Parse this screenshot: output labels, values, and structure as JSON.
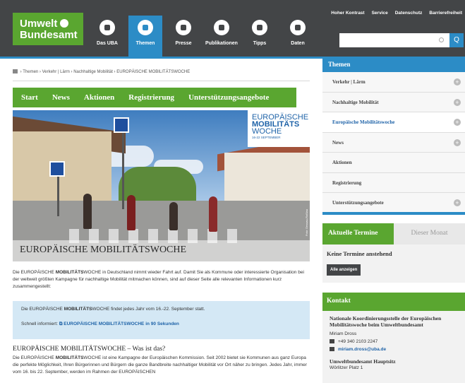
{
  "header": {
    "logo_line1": "Umwelt",
    "logo_line2": "Bundesamt",
    "nav": [
      {
        "label": "Das UBA",
        "icon": "speech-bubble-icon"
      },
      {
        "label": "Themen",
        "icon": "grid-icon",
        "active": true
      },
      {
        "label": "Presse",
        "icon": "megaphone-icon"
      },
      {
        "label": "Publikationen",
        "icon": "document-icon"
      },
      {
        "label": "Tipps",
        "icon": "lightbulb-icon"
      },
      {
        "label": "Daten",
        "icon": "bar-chart-icon"
      }
    ],
    "toplinks": [
      "Hoher Kontrast",
      "Service",
      "Datenschutz",
      "Barrierefreiheit"
    ],
    "search_placeholder": "",
    "search_button": "Q"
  },
  "breadcrumb": [
    "Themen",
    "Verkehr | Lärm",
    "Nachhaltige Mobilität",
    "EUROPÄISCHE MOBILITÄTSWOCHE"
  ],
  "subnav": [
    "Start",
    "News",
    "Aktionen",
    "Registrierung",
    "Unterstützungsangebote"
  ],
  "hero": {
    "badge_line1": "EUROPÄISCHE",
    "badge_line2": "MOBILITÄTS",
    "badge_line3": "WOCHE",
    "badge_dates": "16-22 SEPTEMBER",
    "title": "EUROPÄISCHE MOBILITÄTSWOCHE",
    "credit": "Foto: Dessau-Roßlau"
  },
  "intro": {
    "pre": "Die EUROPÄISCHE ",
    "bold": "MOBILITÄTS",
    "post": "WOCHE in Deutschland nimmt wieder Fahrt auf. Damit Sie als Kommune oder interessierte Organisation bei der weltweit größten Kampagne für nachhaltige Mobilität mitmachen können, sind auf dieser Seite alle relevanten Informationen kurz zusammengestellt:"
  },
  "infobox": {
    "l1_pre": "Die EUROPÄISCHE ",
    "l1_bold": "MOBILITÄTS",
    "l1_post": "WOCHE findet jedes Jahr vom 16.-22. September statt.",
    "l2_pre": "Schnell informiert: ",
    "l2_link": "EUROPÄISCHE MOBILITÄTSWOCHE in 90 Sekunden"
  },
  "section": {
    "heading": "EUROPÄISCHE MOBILITÄTSWOCHE – Was ist das?",
    "text_pre": "Die EUROPÄISCHE ",
    "text_bold": "MOBILITÄTS",
    "text_post": "WOCHE ist eine Kampagne der Europäischen Kommission. Seit 2002 bietet sie Kommunen aus ganz Europa die perfekte Möglichkeit, Ihren Bürgerinnen und Bürgern die ganze Bandbreite nachhaltiger Mobilität vor Ort näher zu bringen. Jedes Jahr, immer vom 16. bis 22. September, werden im Rahmen der EUROPÄISCHEN"
  },
  "sidebar": {
    "heading": "Themen",
    "items": [
      {
        "label": "Verkehr | Lärm",
        "plus": true
      },
      {
        "label": "Nachhaltige Mobilität",
        "plus": true
      },
      {
        "label": "Europäische Mobilitätswoche",
        "plus": true,
        "active": true
      },
      {
        "label": "News",
        "plus": true
      },
      {
        "label": "Aktionen",
        "plus": false
      },
      {
        "label": "Registrierung",
        "plus": false
      },
      {
        "label": "Unterstützungsangebote",
        "plus": true
      }
    ]
  },
  "termine": {
    "tab_active": "Aktuelle Termine",
    "tab_inactive": "Dieser Monat",
    "none": "Keine Termine anstehend",
    "button": "Alle anzeigen"
  },
  "kontakt": {
    "heading": "Kontakt",
    "org": "Nationale Koordinierungsstelle der Europäischen Mobilitätswoche beim Umweltbundesamt",
    "name": "Miriam Dross",
    "phone": "+49 340 2103 2247",
    "email": "miriam.dross@uba.de",
    "org2": "Umweltbundesamt Hauptsitz",
    "street": "Wörlitzer Platz 1"
  },
  "colors": {
    "green": "#5aa630",
    "blue": "#2c8cc6",
    "dark": "#434547"
  }
}
